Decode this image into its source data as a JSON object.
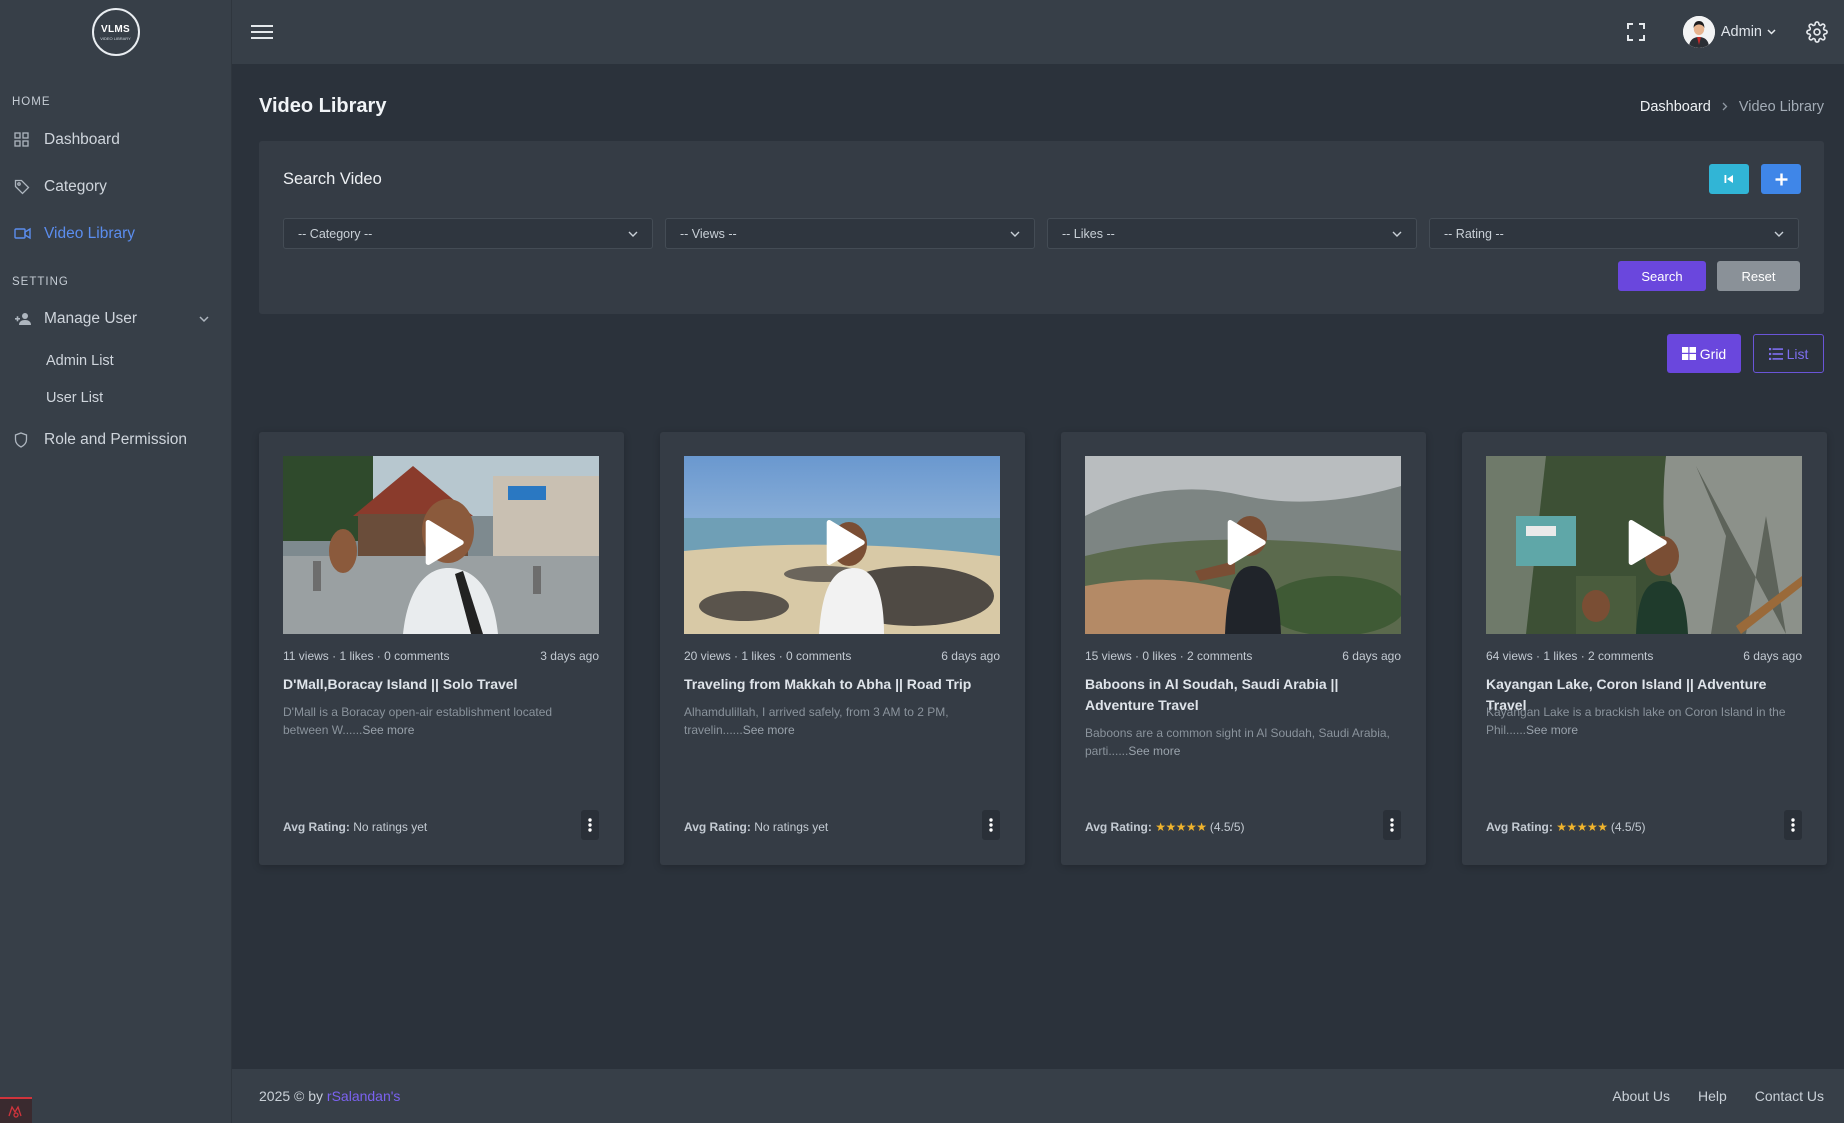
{
  "app": {
    "logo_text": "VLMS",
    "logo_subtext": "VIDEO LIBRARY"
  },
  "sidebar": {
    "sections": [
      {
        "label": "HOME"
      },
      {
        "label": "SETTING"
      }
    ],
    "items": [
      {
        "label": "Dashboard",
        "icon": "grid-icon"
      },
      {
        "label": "Category",
        "icon": "tag-icon"
      },
      {
        "label": "Video Library",
        "icon": "video-icon",
        "active": true
      },
      {
        "label": "Manage User",
        "icon": "users-icon"
      },
      {
        "label": "Admin List"
      },
      {
        "label": "User List"
      },
      {
        "label": "Role and Permission",
        "icon": "shield-icon"
      }
    ]
  },
  "topbar": {
    "user_name": "Admin"
  },
  "page": {
    "title": "Video Library",
    "breadcrumb": {
      "home": "Dashboard",
      "current": "Video Library"
    }
  },
  "search": {
    "title": "Search Video",
    "filters": [
      {
        "value": "-- Category --"
      },
      {
        "value": "-- Views --"
      },
      {
        "value": "-- Likes --"
      },
      {
        "value": "-- Rating --"
      }
    ],
    "search_label": "Search",
    "reset_label": "Reset"
  },
  "view_toggle": {
    "grid_label": "Grid",
    "list_label": "List"
  },
  "videos": [
    {
      "meta": "11 views · 1 likes · 0 comments",
      "age": "3 days ago",
      "title": "D'Mall,Boracay Island || Solo Travel",
      "desc": "D'Mall is a Boracay open-air establishment located between W......",
      "see_more": "See more",
      "rating_label": "Avg Rating:",
      "rating_stars": "",
      "rating_text": "No ratings yet",
      "theme": "city"
    },
    {
      "meta": "20 views · 1 likes · 0 comments",
      "age": "6 days ago",
      "title": "Traveling from Makkah to Abha || Road Trip",
      "desc": "Alhamdulillah, I arrived safely, from 3 AM to 2 PM, travelin......",
      "see_more": "See more",
      "rating_label": "Avg Rating:",
      "rating_stars": "",
      "rating_text": "No ratings yet",
      "theme": "beach"
    },
    {
      "meta": "15 views · 0 likes · 2 comments",
      "age": "6 days ago",
      "title": "Baboons in Al Soudah, Saudi Arabia || Adventure Travel",
      "desc": "Baboons are a common sight in Al Soudah, Saudi Arabia, parti......",
      "see_more": "See more",
      "rating_label": "Avg Rating:",
      "rating_stars": "★★★★★",
      "rating_text": "(4.5/5)",
      "theme": "mountain"
    },
    {
      "meta": "64 views · 1 likes · 2 comments",
      "age": "6 days ago",
      "title": "Kayangan Lake, Coron Island || Adventure Travel",
      "desc": "Kayangan Lake is a brackish lake on Coron Island in the Phil......",
      "see_more": "See more",
      "rating_label": "Avg Rating:",
      "rating_stars": "★★★★★",
      "rating_text": "(4.5/5)",
      "theme": "jungle"
    }
  ],
  "footer": {
    "copyright": "2025 © by",
    "brand": "rSalandan's",
    "links": [
      "About Us",
      "Help",
      "Contact Us"
    ]
  },
  "colors": {
    "accent": "#6a47dd",
    "active_link": "#5b8dee",
    "star": "#f0b42d",
    "sidebar_bg": "#373f48",
    "page_bg": "#2b323b"
  }
}
